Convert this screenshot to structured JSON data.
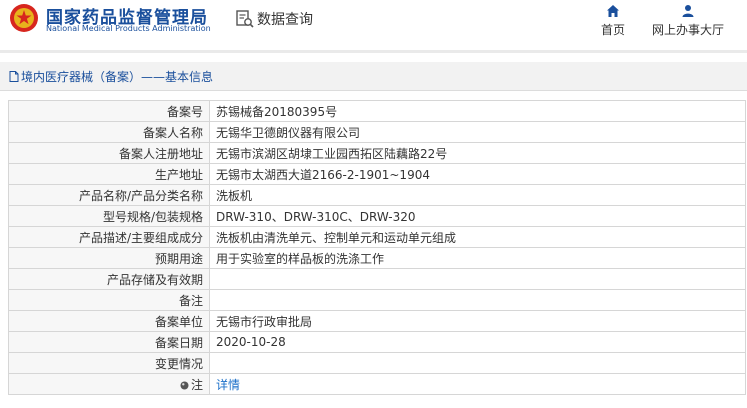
{
  "header": {
    "org_cn": "国家药品监督管理局",
    "org_en": "National Medical Products Administration",
    "query_label": "数据查询",
    "nav": {
      "home": "首页",
      "online": "网上办事大厅"
    }
  },
  "breadcrumb": {
    "text": "境内医疗器械（备案）——基本信息"
  },
  "rows": [
    {
      "label": "备案号",
      "value": "苏锡械备20180395号"
    },
    {
      "label": "备案人名称",
      "value": "无锡华卫德朗仪器有限公司"
    },
    {
      "label": "备案人注册地址",
      "value": "无锡市滨湖区胡埭工业园西拓区陆藕路22号"
    },
    {
      "label": "生产地址",
      "value": "无锡市太湖西大道2166-2-1901~1904"
    },
    {
      "label": "产品名称/产品分类名称",
      "value": "洗板机"
    },
    {
      "label": "型号规格/包装规格",
      "value": "DRW-310、DRW-310C、DRW-320"
    },
    {
      "label": "产品描述/主要组成成分",
      "value": "洗板机由清洗单元、控制单元和运动单元组成"
    },
    {
      "label": "预期用途",
      "value": "用于实验室的样品板的洗涤工作"
    },
    {
      "label": "产品存储及有效期",
      "value": ""
    },
    {
      "label": "备注",
      "value": ""
    },
    {
      "label": "备案单位",
      "value": "无锡市行政审批局"
    },
    {
      "label": "备案日期",
      "value": "2020-10-28"
    },
    {
      "label": "变更情况",
      "value": ""
    }
  ],
  "note_row": {
    "label": "注",
    "link": "详情"
  },
  "colors": {
    "brand_blue": "#1a4f9c",
    "emblem_red": "#d7261e",
    "link_blue": "#1a6fc9"
  }
}
